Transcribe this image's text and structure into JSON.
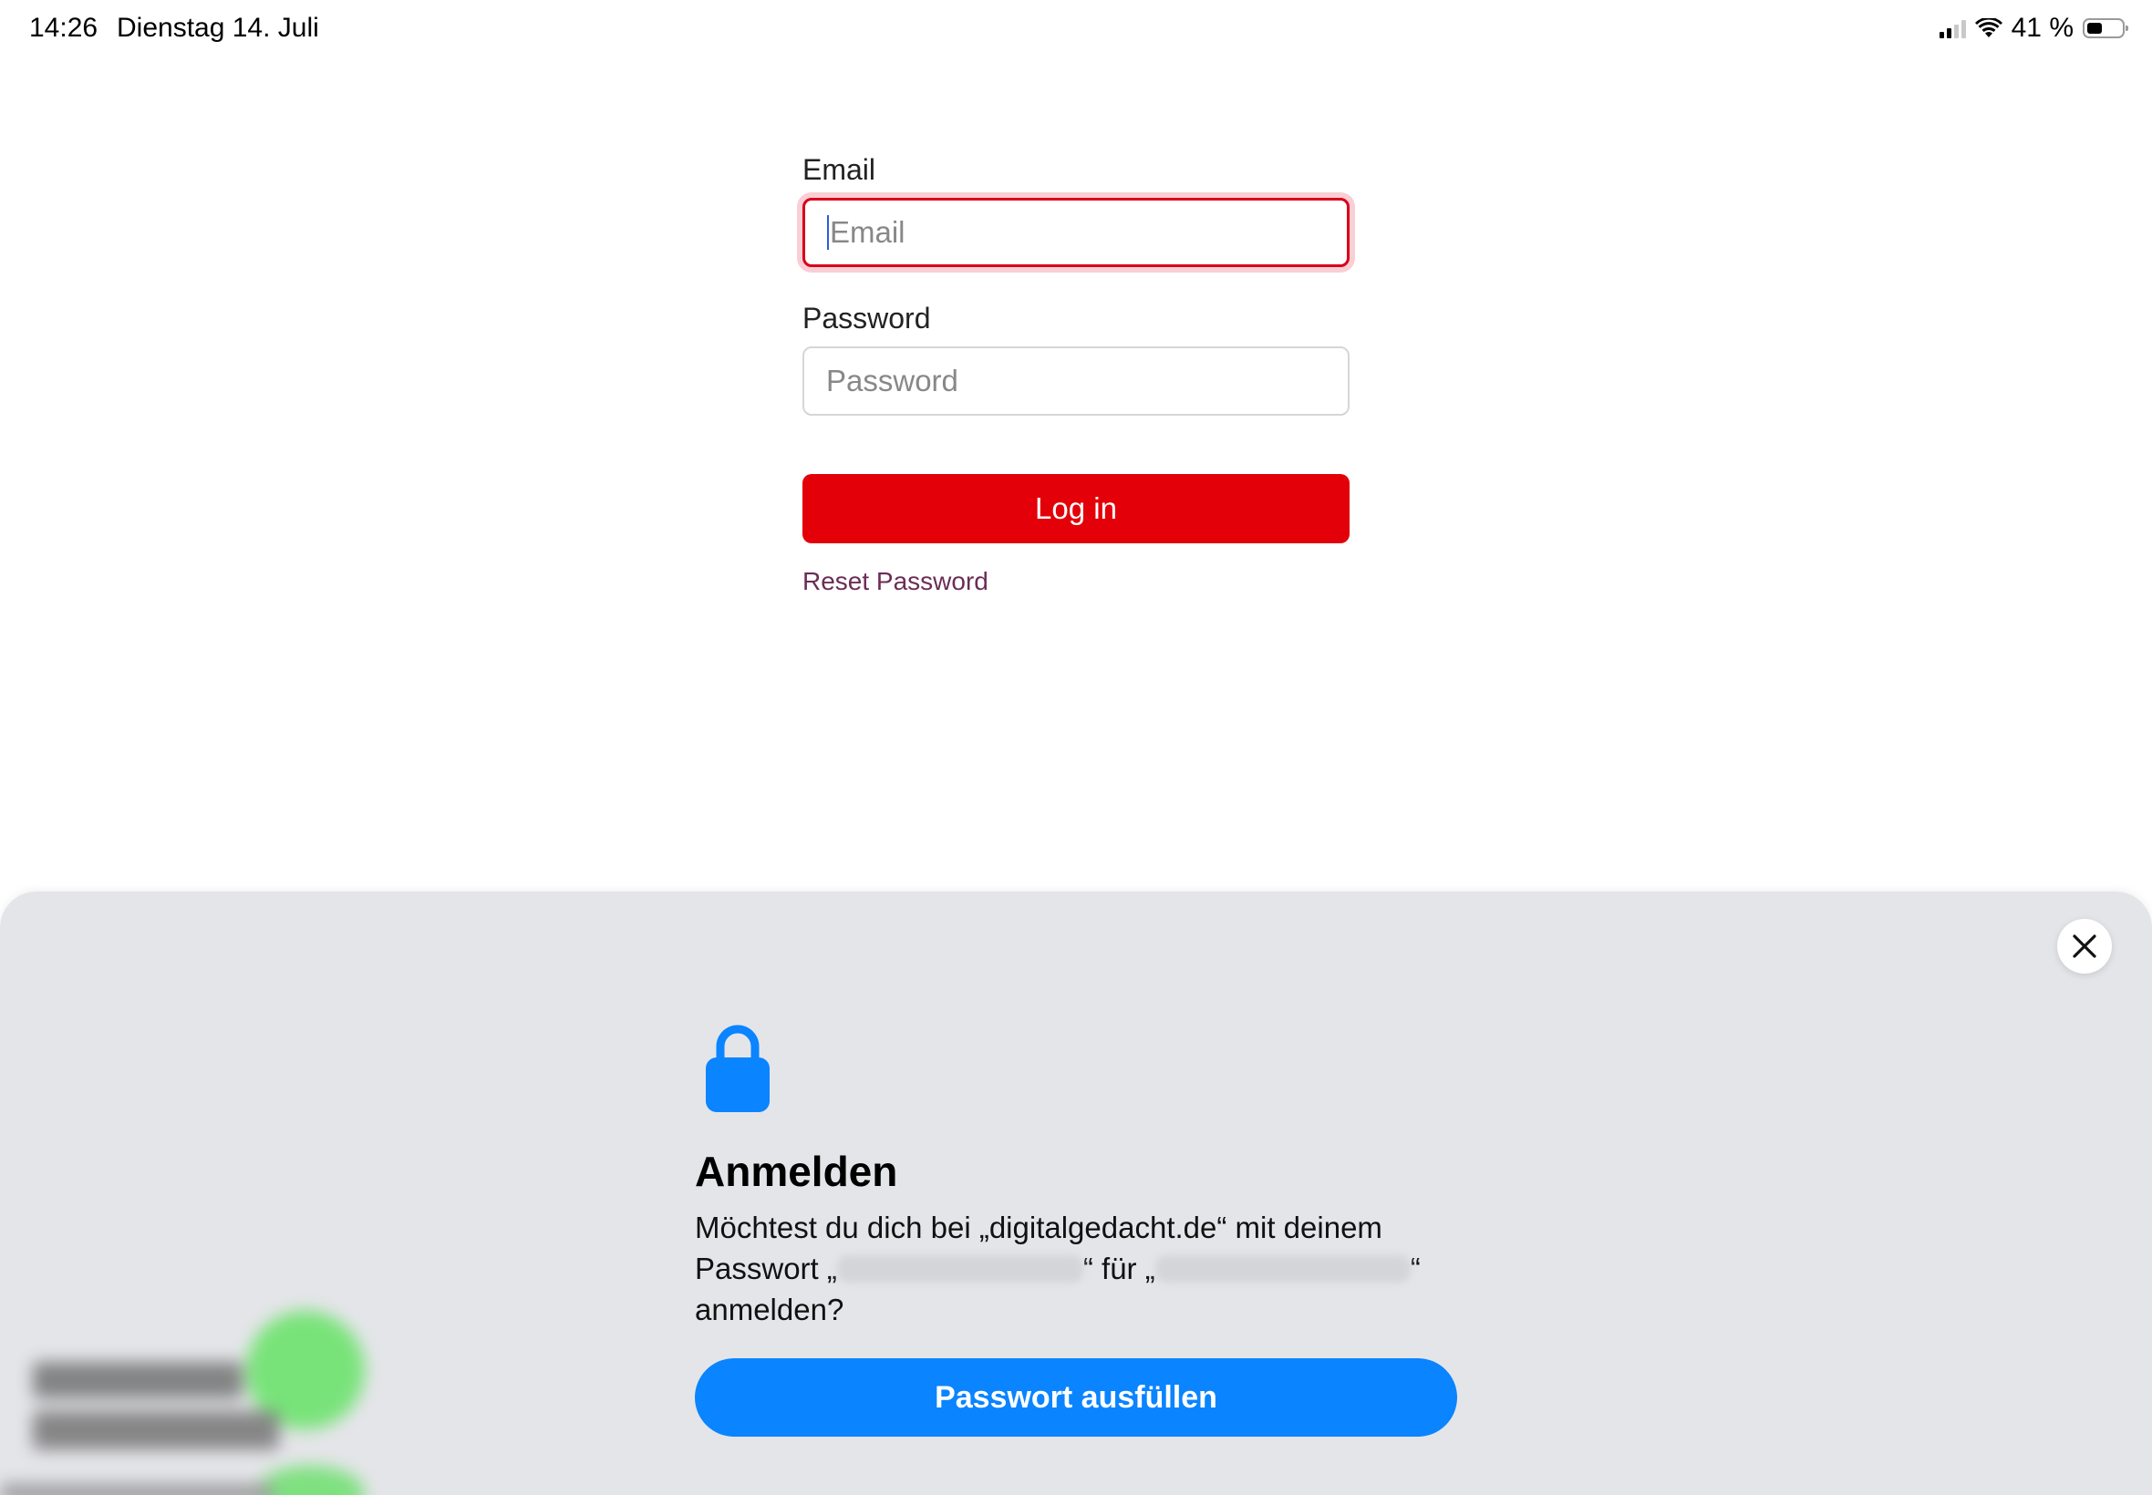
{
  "status_bar": {
    "time": "14:26",
    "date": "Dienstag 14. Juli",
    "battery": "41 %",
    "battery_level": 0.41
  },
  "login_form": {
    "email_label": "Email",
    "email_placeholder": "Email",
    "password_label": "Password",
    "password_placeholder": "Password",
    "login_button": "Log in",
    "reset_link": "Reset Password"
  },
  "password_sheet": {
    "title": "Anmelden",
    "message_part1": "Möchtest du dich bei „digitalgedacht.de“ mit deinem Passwort „",
    "message_part2": "“ für „",
    "message_part3": "“ anmelden?",
    "fill_button": "Passwort ausfüllen",
    "accent_color": "#0a84ff"
  },
  "colors": {
    "login_button": "#e30008",
    "focus_ring": "#d9001b",
    "reset_link": "#6b2d56",
    "sheet_background": "#e4e5e9"
  },
  "icons": {
    "lock": "lock-icon",
    "close": "close-icon",
    "wifi": "wifi-icon",
    "signal": "cellular-signal-icon",
    "battery": "battery-icon"
  }
}
